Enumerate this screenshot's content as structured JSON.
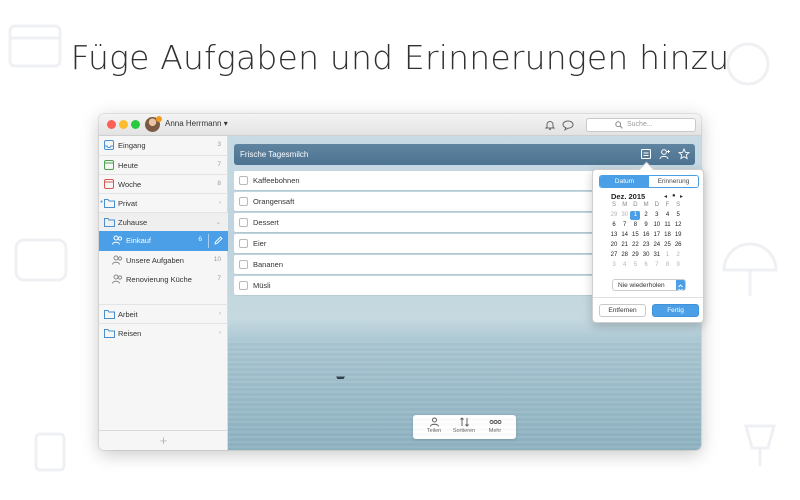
{
  "headline": "Füge Aufgaben und Erinnerungen hinzu",
  "window": {
    "user_name": "Anna Herrmann",
    "search_placeholder": "Suche..."
  },
  "sidebar": {
    "items": [
      {
        "label": "Eingang",
        "count": "3",
        "icon": "inbox-icon"
      },
      {
        "label": "Heute",
        "count": "7",
        "icon": "today-calendar-icon"
      },
      {
        "label": "Woche",
        "count": "8",
        "icon": "week-calendar-icon"
      },
      {
        "label": "Privat",
        "count": "",
        "icon": "folder-icon"
      },
      {
        "label": "Zuhause",
        "count": "",
        "icon": "folder-icon"
      },
      {
        "label": "Einkauf",
        "count": "6",
        "icon": "shared-list-icon"
      },
      {
        "label": "Unsere Aufgaben",
        "count": "10",
        "icon": "shared-list-icon"
      },
      {
        "label": "Renovierung Küche",
        "count": "7",
        "icon": "shared-list-icon"
      },
      {
        "label": "Arbeit",
        "count": "",
        "icon": "folder-icon"
      },
      {
        "label": "Reisen",
        "count": "",
        "icon": "folder-icon"
      }
    ],
    "add_label": "+"
  },
  "main": {
    "list_title": "Frische Tagesmilch",
    "tasks": [
      "Kaffeebohnen",
      "Orangensaft",
      "Dessert",
      "Eier",
      "Bananen",
      "Müsli"
    ],
    "bottom_bar": {
      "share": "Teilen",
      "sort": "Sortieren",
      "more": "Mehr"
    }
  },
  "popover": {
    "tab_date": "Datum",
    "tab_reminder": "Erinnerung",
    "month": "Dez. 2015",
    "weekdays": [
      "S",
      "M",
      "D",
      "M",
      "D",
      "F",
      "S"
    ],
    "weeks": [
      [
        "29",
        "30",
        "1",
        "2",
        "3",
        "4",
        "5"
      ],
      [
        "6",
        "7",
        "8",
        "9",
        "10",
        "11",
        "12"
      ],
      [
        "13",
        "14",
        "15",
        "16",
        "17",
        "18",
        "19"
      ],
      [
        "20",
        "21",
        "22",
        "23",
        "24",
        "25",
        "26"
      ],
      [
        "27",
        "28",
        "29",
        "30",
        "31",
        "1",
        "2"
      ],
      [
        "3",
        "4",
        "5",
        "6",
        "7",
        "8",
        "9"
      ]
    ],
    "selected_day": "1",
    "repeat_value": "Nie wiederholen",
    "remove_label": "Entfernen",
    "done_label": "Fertig"
  },
  "colors": {
    "accent": "#4a9fe6",
    "header_bar": "#557a97"
  }
}
